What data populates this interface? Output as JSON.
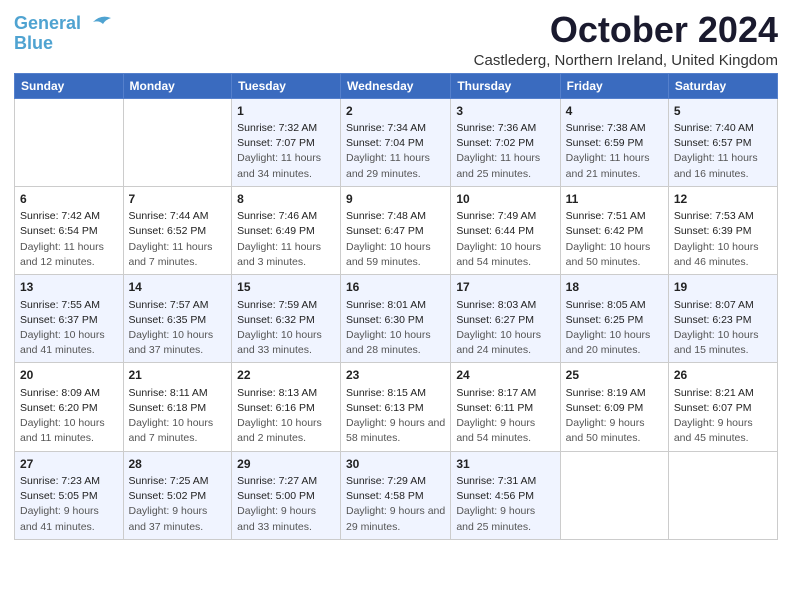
{
  "logo": {
    "line1": "General",
    "line2": "Blue"
  },
  "title": "October 2024",
  "subtitle": "Castlederg, Northern Ireland, United Kingdom",
  "weekdays": [
    "Sunday",
    "Monday",
    "Tuesday",
    "Wednesday",
    "Thursday",
    "Friday",
    "Saturday"
  ],
  "weeks": [
    [
      {
        "day": "",
        "sunrise": "",
        "sunset": "",
        "daylight": ""
      },
      {
        "day": "",
        "sunrise": "",
        "sunset": "",
        "daylight": ""
      },
      {
        "day": "1",
        "sunrise": "Sunrise: 7:32 AM",
        "sunset": "Sunset: 7:07 PM",
        "daylight": "Daylight: 11 hours and 34 minutes."
      },
      {
        "day": "2",
        "sunrise": "Sunrise: 7:34 AM",
        "sunset": "Sunset: 7:04 PM",
        "daylight": "Daylight: 11 hours and 29 minutes."
      },
      {
        "day": "3",
        "sunrise": "Sunrise: 7:36 AM",
        "sunset": "Sunset: 7:02 PM",
        "daylight": "Daylight: 11 hours and 25 minutes."
      },
      {
        "day": "4",
        "sunrise": "Sunrise: 7:38 AM",
        "sunset": "Sunset: 6:59 PM",
        "daylight": "Daylight: 11 hours and 21 minutes."
      },
      {
        "day": "5",
        "sunrise": "Sunrise: 7:40 AM",
        "sunset": "Sunset: 6:57 PM",
        "daylight": "Daylight: 11 hours and 16 minutes."
      }
    ],
    [
      {
        "day": "6",
        "sunrise": "Sunrise: 7:42 AM",
        "sunset": "Sunset: 6:54 PM",
        "daylight": "Daylight: 11 hours and 12 minutes."
      },
      {
        "day": "7",
        "sunrise": "Sunrise: 7:44 AM",
        "sunset": "Sunset: 6:52 PM",
        "daylight": "Daylight: 11 hours and 7 minutes."
      },
      {
        "day": "8",
        "sunrise": "Sunrise: 7:46 AM",
        "sunset": "Sunset: 6:49 PM",
        "daylight": "Daylight: 11 hours and 3 minutes."
      },
      {
        "day": "9",
        "sunrise": "Sunrise: 7:48 AM",
        "sunset": "Sunset: 6:47 PM",
        "daylight": "Daylight: 10 hours and 59 minutes."
      },
      {
        "day": "10",
        "sunrise": "Sunrise: 7:49 AM",
        "sunset": "Sunset: 6:44 PM",
        "daylight": "Daylight: 10 hours and 54 minutes."
      },
      {
        "day": "11",
        "sunrise": "Sunrise: 7:51 AM",
        "sunset": "Sunset: 6:42 PM",
        "daylight": "Daylight: 10 hours and 50 minutes."
      },
      {
        "day": "12",
        "sunrise": "Sunrise: 7:53 AM",
        "sunset": "Sunset: 6:39 PM",
        "daylight": "Daylight: 10 hours and 46 minutes."
      }
    ],
    [
      {
        "day": "13",
        "sunrise": "Sunrise: 7:55 AM",
        "sunset": "Sunset: 6:37 PM",
        "daylight": "Daylight: 10 hours and 41 minutes."
      },
      {
        "day": "14",
        "sunrise": "Sunrise: 7:57 AM",
        "sunset": "Sunset: 6:35 PM",
        "daylight": "Daylight: 10 hours and 37 minutes."
      },
      {
        "day": "15",
        "sunrise": "Sunrise: 7:59 AM",
        "sunset": "Sunset: 6:32 PM",
        "daylight": "Daylight: 10 hours and 33 minutes."
      },
      {
        "day": "16",
        "sunrise": "Sunrise: 8:01 AM",
        "sunset": "Sunset: 6:30 PM",
        "daylight": "Daylight: 10 hours and 28 minutes."
      },
      {
        "day": "17",
        "sunrise": "Sunrise: 8:03 AM",
        "sunset": "Sunset: 6:27 PM",
        "daylight": "Daylight: 10 hours and 24 minutes."
      },
      {
        "day": "18",
        "sunrise": "Sunrise: 8:05 AM",
        "sunset": "Sunset: 6:25 PM",
        "daylight": "Daylight: 10 hours and 20 minutes."
      },
      {
        "day": "19",
        "sunrise": "Sunrise: 8:07 AM",
        "sunset": "Sunset: 6:23 PM",
        "daylight": "Daylight: 10 hours and 15 minutes."
      }
    ],
    [
      {
        "day": "20",
        "sunrise": "Sunrise: 8:09 AM",
        "sunset": "Sunset: 6:20 PM",
        "daylight": "Daylight: 10 hours and 11 minutes."
      },
      {
        "day": "21",
        "sunrise": "Sunrise: 8:11 AM",
        "sunset": "Sunset: 6:18 PM",
        "daylight": "Daylight: 10 hours and 7 minutes."
      },
      {
        "day": "22",
        "sunrise": "Sunrise: 8:13 AM",
        "sunset": "Sunset: 6:16 PM",
        "daylight": "Daylight: 10 hours and 2 minutes."
      },
      {
        "day": "23",
        "sunrise": "Sunrise: 8:15 AM",
        "sunset": "Sunset: 6:13 PM",
        "daylight": "Daylight: 9 hours and 58 minutes."
      },
      {
        "day": "24",
        "sunrise": "Sunrise: 8:17 AM",
        "sunset": "Sunset: 6:11 PM",
        "daylight": "Daylight: 9 hours and 54 minutes."
      },
      {
        "day": "25",
        "sunrise": "Sunrise: 8:19 AM",
        "sunset": "Sunset: 6:09 PM",
        "daylight": "Daylight: 9 hours and 50 minutes."
      },
      {
        "day": "26",
        "sunrise": "Sunrise: 8:21 AM",
        "sunset": "Sunset: 6:07 PM",
        "daylight": "Daylight: 9 hours and 45 minutes."
      }
    ],
    [
      {
        "day": "27",
        "sunrise": "Sunrise: 7:23 AM",
        "sunset": "Sunset: 5:05 PM",
        "daylight": "Daylight: 9 hours and 41 minutes."
      },
      {
        "day": "28",
        "sunrise": "Sunrise: 7:25 AM",
        "sunset": "Sunset: 5:02 PM",
        "daylight": "Daylight: 9 hours and 37 minutes."
      },
      {
        "day": "29",
        "sunrise": "Sunrise: 7:27 AM",
        "sunset": "Sunset: 5:00 PM",
        "daylight": "Daylight: 9 hours and 33 minutes."
      },
      {
        "day": "30",
        "sunrise": "Sunrise: 7:29 AM",
        "sunset": "Sunset: 4:58 PM",
        "daylight": "Daylight: 9 hours and 29 minutes."
      },
      {
        "day": "31",
        "sunrise": "Sunrise: 7:31 AM",
        "sunset": "Sunset: 4:56 PM",
        "daylight": "Daylight: 9 hours and 25 minutes."
      },
      {
        "day": "",
        "sunrise": "",
        "sunset": "",
        "daylight": ""
      },
      {
        "day": "",
        "sunrise": "",
        "sunset": "",
        "daylight": ""
      }
    ]
  ]
}
